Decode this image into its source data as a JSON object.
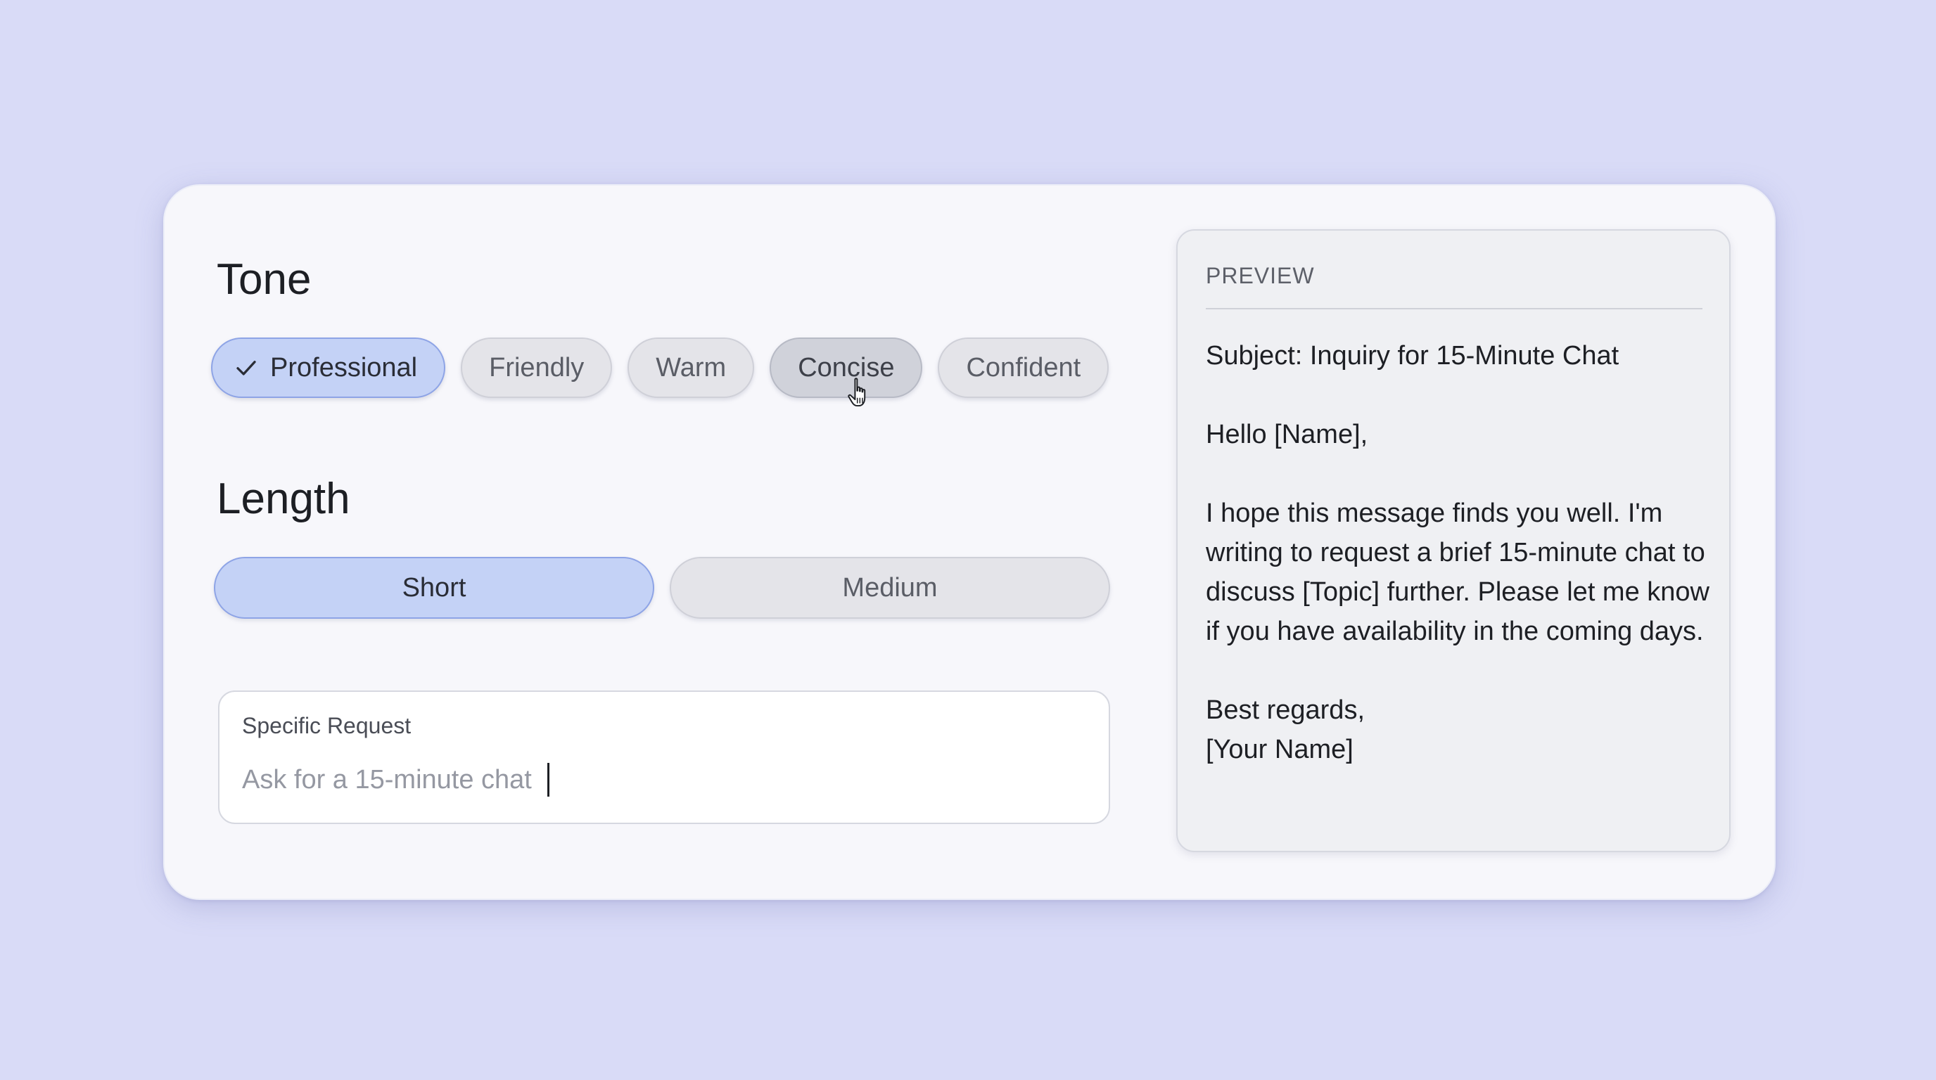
{
  "tone": {
    "title": "Tone",
    "options": [
      {
        "label": "Professional",
        "selected": true
      },
      {
        "label": "Friendly",
        "selected": false
      },
      {
        "label": "Warm",
        "selected": false
      },
      {
        "label": "Concise",
        "selected": false,
        "hovered": true
      },
      {
        "label": "Confident",
        "selected": false
      }
    ]
  },
  "length": {
    "title": "Length",
    "options": [
      {
        "label": "Short",
        "selected": true
      },
      {
        "label": "Medium",
        "selected": false
      }
    ]
  },
  "request": {
    "label": "Specific Request",
    "placeholder": "Ask for a 15-minute chat",
    "value": ""
  },
  "preview": {
    "label": "PREVIEW",
    "subject": "Subject: Inquiry for 15-Minute Chat",
    "greeting": "Hello [Name],",
    "body": "I hope this message finds you well. I'm writing to request a brief 15-minute chat to discuss [Topic] further. Please let me know if you have availability in the coming days.",
    "signoff": "Best regards,",
    "signature": "[Your Name]"
  },
  "colors": {
    "background": "#d9dbf7",
    "selected_fill": "#c4d2f6",
    "selected_border": "#8ea4e6",
    "chip_fill": "#e4e4e9"
  },
  "icons": {
    "check": "check-icon",
    "pointer": "hand-pointer-icon"
  }
}
